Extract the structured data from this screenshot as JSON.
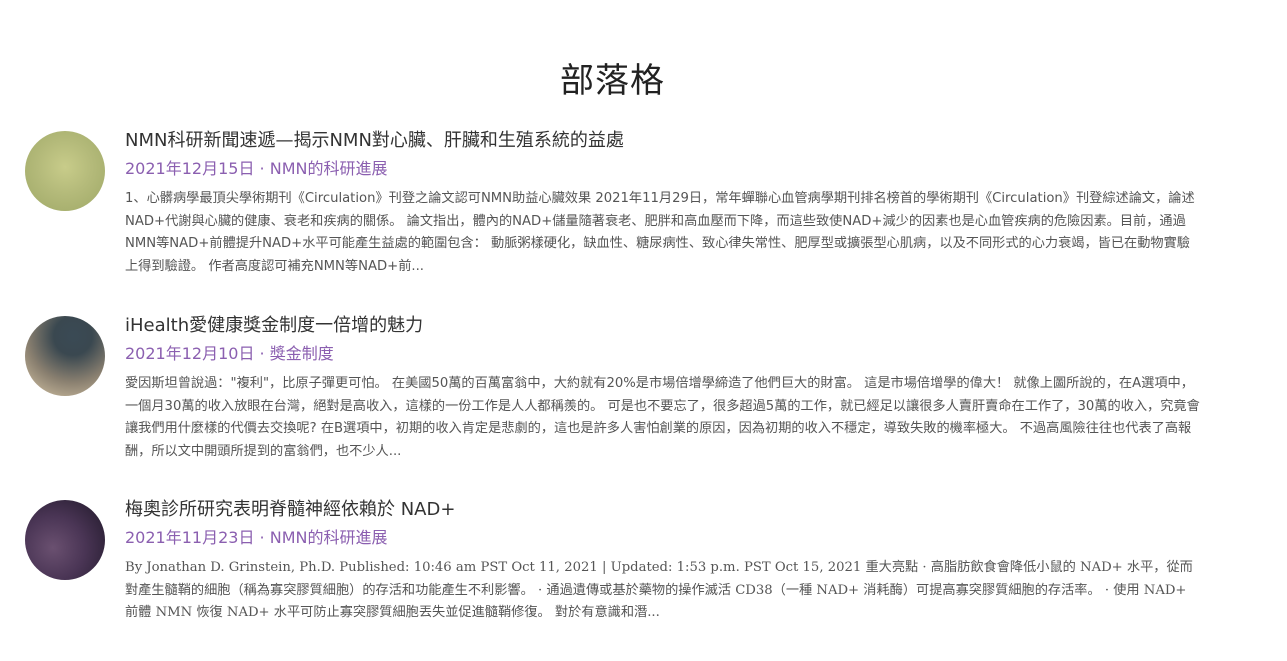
{
  "page": {
    "title": "部落格"
  },
  "posts": [
    {
      "title": "NMN科研新聞速遞—揭示NMN對心臟、肝臟和生殖系統的益處",
      "date": "2021年12月15日",
      "separator": " · ",
      "category": "NMN的科研進展",
      "excerpt": "1、心髒病學最頂尖學術期刊《Circulation》刊登之論文認可NMN助益心臟效果 2021年11月29日，常年蟬聯心血管病學期刊排名榜首的學術期刊《Circulation》刊登綜述論文，論述NAD+代謝與心臟的健康、衰老和疾病的關係。 論文指出，體內的NAD+儲量隨著衰老、肥胖和高血壓而下降，而這些致使NAD+減少的因素也是心血管疾病的危險因素。目前，通過NMN等NAD+前體提升NAD+水平可能產生益處的範圍包含： 動脈粥樣硬化，缺血性、糖尿病性、致心律失常性、肥厚型或擴張型心肌病，以及不同形式的心力衰竭，皆已在動物實驗上得到驗證。 作者高度認可補充NMN等NAD+前...",
      "thumb": "olive-green-blur"
    },
    {
      "title": "iHealth愛健康獎金制度一倍增的魅力",
      "date": "2021年12月10日",
      "separator": " · ",
      "category": "獎金制度",
      "excerpt": " 愛因斯坦曾說過：\"複利\"，比原子彈更可怕。  在美國50萬的百萬富翁中，大約就有20%是市場倍增學締造了他們巨大的財富。  這是市場倍增學的偉大！   就像上圖所說的，在A選項中，一個月30萬的收入放眼在台灣，絕對是高收入，這樣的一份工作是人人都稱羨的。 可是也不要忘了，很多超過5萬的工作，就已經足以讓很多人賣肝賣命在工作了，30萬的收入，究竟會讓我們用什麼樣的代價去交換呢? 在B選項中，初期的收入肯定是悲劇的，這也是許多人害怕創業的原因，因為初期的收入不穩定，導致失敗的機率極大。 不過高風險往往也代表了高報酬，所以文中開頭所提到的富翁們，也不少人...",
      "thumb": "slate-tan-blur"
    },
    {
      "title": "梅奧診所研究表明脊髓神經依賴於 NAD+",
      "date": "2021年11月23日",
      "separator": " · ",
      "category": "NMN的科研進展",
      "excerpt": "By Jonathan D. Grinstein, Ph.D.          Published: 10:46 am PST Oct 11, 2021 | Updated: 1:53 p.m. PST Oct 15, 2021 重大亮點 · 高脂肪飲食會降低小鼠的 NAD+ 水平，從而對產生髓鞘的細胞（稱為寡突膠質細胞）的存活和功能產生不利影響。 · 通過遺傳或基於藥物的操作滅活 CD38（一種 NAD+ 消耗酶）可提高寡突膠質細胞的存活率。 · 使用 NAD+ 前體 NMN 恢復 NAD+ 水平可防止寡突膠質細胞丟失並促進髓鞘修復。  對於有意識和潛...",
      "thumb": "plum-dark-blur"
    }
  ]
}
